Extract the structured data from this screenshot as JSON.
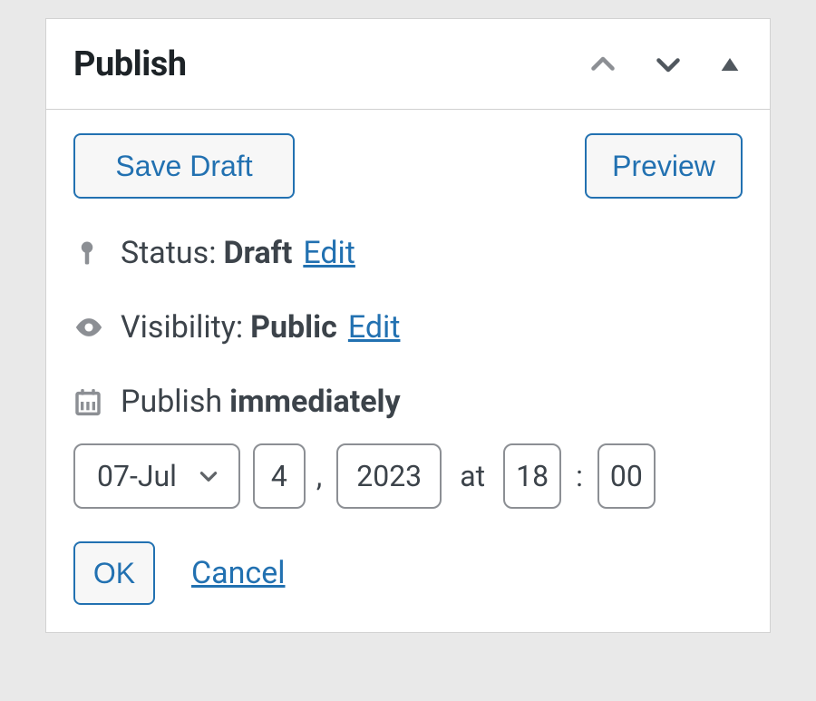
{
  "panel": {
    "title": "Publish",
    "save_draft_label": "Save Draft",
    "preview_label": "Preview"
  },
  "status": {
    "label": "Status:",
    "value": "Draft",
    "edit_label": "Edit"
  },
  "visibility": {
    "label": "Visibility:",
    "value": "Public",
    "edit_label": "Edit"
  },
  "publish": {
    "label": "Publish",
    "time_word": "immediately"
  },
  "schedule": {
    "month": "07-Jul",
    "day": "4",
    "year": "2023",
    "at_label": "at",
    "hour": "18",
    "minute": "00"
  },
  "actions": {
    "ok_label": "OK",
    "cancel_label": "Cancel"
  }
}
